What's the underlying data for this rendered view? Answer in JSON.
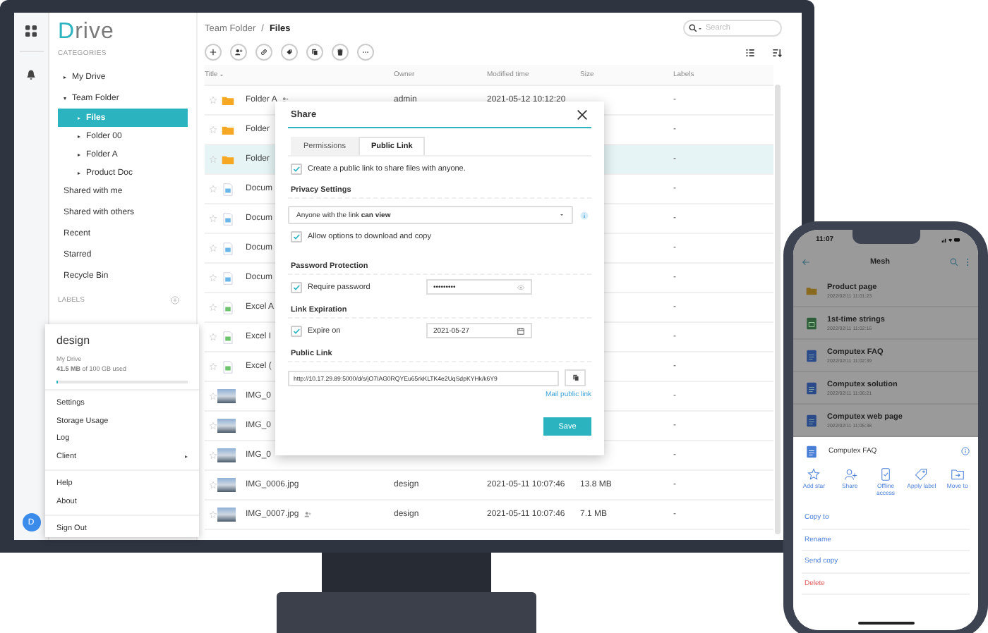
{
  "rail": {
    "avatar": "D"
  },
  "sidebar": {
    "logo": "Drive",
    "categories": "CATEGORIES",
    "tree": [
      {
        "label": "My Drive",
        "expanded": false,
        "selected": false
      },
      {
        "label": "Team Folder",
        "expanded": true,
        "selected": false,
        "children": [
          {
            "label": "Files",
            "expanded": false,
            "selected": true
          },
          {
            "label": "Folder 00",
            "expanded": false,
            "selected": false
          },
          {
            "label": "Folder A",
            "expanded": false,
            "selected": false
          },
          {
            "label": "Product Doc",
            "expanded": false,
            "selected": false
          }
        ]
      }
    ],
    "links": [
      {
        "label": "Shared with me",
        "selected": false
      },
      {
        "label": "Shared with others",
        "selected": false
      },
      {
        "label": "Recent",
        "selected": false
      },
      {
        "label": "Starred",
        "selected": false
      },
      {
        "label": "Recycle Bin",
        "selected": false
      }
    ],
    "labels_heading": "LABELS"
  },
  "user_menu": {
    "name": "design",
    "drive": "My Drive",
    "usage": "**41.5 MB** of 100 GB used",
    "level": 0.01,
    "groups": [
      [
        {
          "label": "Settings",
          "submenu": false
        },
        {
          "label": "Storage Usage",
          "submenu": false
        },
        {
          "label": "Log",
          "submenu": false
        },
        {
          "label": "Client",
          "submenu": true
        }
      ],
      [
        {
          "label": "Help",
          "submenu": false
        },
        {
          "label": "About",
          "submenu": false
        }
      ],
      [
        {
          "label": "Sign Out",
          "submenu": false
        }
      ]
    ]
  },
  "main": {
    "breadcrumb": [
      "Team Folder",
      "Files"
    ],
    "separator": "/",
    "search": {
      "placeholder": "Search"
    },
    "columns": [
      "Title",
      "Owner",
      "Modified time",
      "Size",
      "Labels"
    ],
    "rows": [
      {
        "kind": "folder",
        "name": "Folder A",
        "shared": true,
        "owner": "admin",
        "modified": "2021-05-12 10:12:20",
        "labels": "-",
        "selected": false
      },
      {
        "kind": "folder",
        "name": "Folder",
        "shared": false,
        "labels": "-",
        "selected": false
      },
      {
        "kind": "folder",
        "name": "Folder",
        "shared": false,
        "labels": "-",
        "selected": true
      },
      {
        "kind": "doc",
        "name": "Docum",
        "shared": false,
        "labels": "-",
        "selected": false
      },
      {
        "kind": "doc",
        "name": "Docum",
        "shared": false,
        "labels": "-",
        "selected": false
      },
      {
        "kind": "doc",
        "name": "Docum",
        "shared": false,
        "labels": "-",
        "selected": false
      },
      {
        "kind": "doc",
        "name": "Docum",
        "shared": false,
        "labels": "-",
        "selected": false
      },
      {
        "kind": "sheet",
        "name": "Excel A",
        "shared": false,
        "labels": "-",
        "selected": false
      },
      {
        "kind": "sheet",
        "name": "Excel I",
        "shared": false,
        "labels": "-",
        "selected": false
      },
      {
        "kind": "sheet",
        "name": "Excel (",
        "shared": false,
        "labels": "-",
        "selected": false
      },
      {
        "kind": "image",
        "name": "IMG_0",
        "shared": false,
        "labels": "-",
        "selected": false
      },
      {
        "kind": "image",
        "name": "IMG_0",
        "shared": false,
        "labels": "-",
        "selected": false
      },
      {
        "kind": "image",
        "name": "IMG_0",
        "shared": false,
        "labels": "-",
        "selected": false
      },
      {
        "kind": "image",
        "name": "IMG_0006.jpg",
        "shared": false,
        "owner": "design",
        "modified": "2021-05-11 10:07:46",
        "size": "13.8 MB",
        "labels": "-",
        "selected": false
      },
      {
        "kind": "image",
        "name": "IMG_0007.jpg",
        "shared": true,
        "owner": "design",
        "modified": "2021-05-11 10:07:46",
        "size": "7.1 MB",
        "labels": "-",
        "selected": false
      }
    ]
  },
  "share_dialog": {
    "title": "Share",
    "tabs": [
      {
        "label": "Permissions",
        "selected": false
      },
      {
        "label": "Public Link",
        "selected": true
      }
    ],
    "create_link": {
      "label": "Create a public link to share files with anyone.",
      "checked": true
    },
    "privacy": {
      "heading": "Privacy Settings",
      "select": "Anyone with the link **can view**",
      "allow": {
        "label": "Allow options to download and copy",
        "checked": true
      }
    },
    "password": {
      "heading": "Password Protection",
      "require": {
        "label": "Require password",
        "checked": true
      },
      "value": "•••••••••"
    },
    "expiration": {
      "heading": "Link Expiration",
      "expire": {
        "label": "Expire on",
        "checked": true
      },
      "date": "2021-05-27"
    },
    "public_link": {
      "heading": "Public Link",
      "url": "http://10.17.29.89:5000/d/s/jO7IAG0RQYEu65rkKLTK4e2UqSdpKYHk/k6Y9",
      "mail": "Mail public link"
    },
    "save": "Save"
  },
  "phone": {
    "time": "11:07",
    "title": "Mesh",
    "files": [
      {
        "kind": "folder",
        "name": "Product page",
        "date": "2022/02/11 11:01:23"
      },
      {
        "kind": "sheet",
        "name": "1st-time strings",
        "date": "2022/02/11 11:02:16"
      },
      {
        "kind": "doc",
        "name": "Computex FAQ",
        "date": "2022/02/11 11:02:39"
      },
      {
        "kind": "doc",
        "name": "Computex solution",
        "date": "2022/02/11 11:06:21"
      },
      {
        "kind": "doc",
        "name": "Computex web page",
        "date": "2022/02/11 11:05:38"
      }
    ],
    "sheet": {
      "file": "Computex FAQ",
      "actions": [
        {
          "kind": "star",
          "label": "Add star"
        },
        {
          "kind": "share",
          "label": "Share"
        },
        {
          "kind": "offline",
          "label": "Offline access"
        },
        {
          "kind": "label",
          "label": "Apply label"
        },
        {
          "kind": "move",
          "label": "Move to"
        }
      ],
      "menu": [
        {
          "kind": "normal",
          "label": "Copy to"
        },
        {
          "kind": "normal",
          "label": "Rename"
        },
        {
          "kind": "normal",
          "label": "Send copy"
        },
        {
          "kind": "danger",
          "label": "Delete"
        }
      ]
    }
  }
}
